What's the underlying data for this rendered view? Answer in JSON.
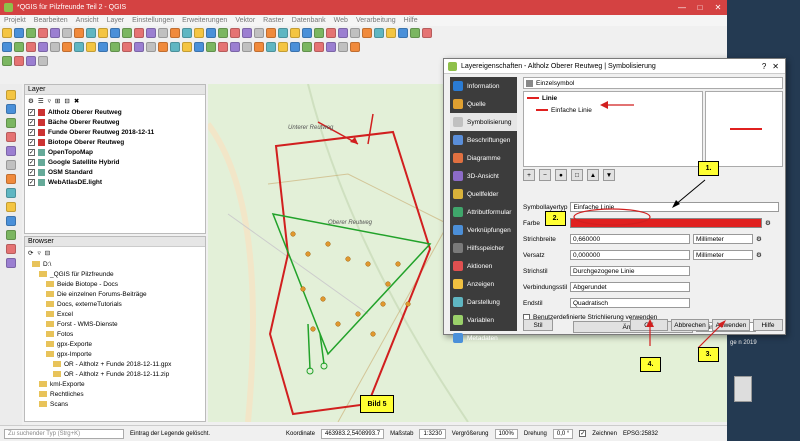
{
  "window": {
    "title": "*QGIS für Pilzfreunde Teil 2 - QGIS"
  },
  "menu": [
    "Projekt",
    "Bearbeiten",
    "Ansicht",
    "Layer",
    "Einstellungen",
    "Erweiterungen",
    "Vektor",
    "Raster",
    "Datenbank",
    "Web",
    "Verarbeitung",
    "Hilfe"
  ],
  "layers_panel": {
    "title": "Layer",
    "items": [
      {
        "label": "Altholz Oberer Reutweg",
        "checked": true
      },
      {
        "label": "Bäche Oberer Reutweg",
        "checked": true
      },
      {
        "label": "Funde Oberer Reutweg 2018-12-11",
        "checked": true
      },
      {
        "label": "Biotope Oberer Reutweg",
        "checked": true
      },
      {
        "label": "OpenTopoMap",
        "checked": true
      },
      {
        "label": "Google Satellite Hybrid",
        "checked": true
      },
      {
        "label": "OSM Standard",
        "checked": true
      },
      {
        "label": "WebAtlasDE.light",
        "checked": true
      }
    ]
  },
  "browser_panel": {
    "title": "Browser",
    "items": [
      {
        "label": "D:\\",
        "depth": 1
      },
      {
        "label": "_QGIS für Pilzfreunde",
        "depth": 2
      },
      {
        "label": "Beide Biotope - Docs",
        "depth": 3
      },
      {
        "label": "Die einzelnen Forums-Beiträge",
        "depth": 3
      },
      {
        "label": "Docs, externeTutorials",
        "depth": 3
      },
      {
        "label": "Excel",
        "depth": 3
      },
      {
        "label": "Forst - WMS-Dienste",
        "depth": 3
      },
      {
        "label": "Fotos",
        "depth": 3
      },
      {
        "label": "gpx-Exporte",
        "depth": 3
      },
      {
        "label": "gpx-Importe",
        "depth": 3
      },
      {
        "label": "OR - Altholz + Funde 2018-12-11.gpx",
        "depth": 4
      },
      {
        "label": "OR - Altholz + Funde 2018-12-11.zip",
        "depth": 4
      },
      {
        "label": "kml-Exporte",
        "depth": 2
      },
      {
        "label": "Rechtliches",
        "depth": 2
      },
      {
        "label": "Scans",
        "depth": 2
      }
    ]
  },
  "map": {
    "labels": [
      "Unterer Reutweg",
      "Oberer Reutweg",
      "Bild 5"
    ]
  },
  "status": {
    "search_placeholder": "Zu suchender Typ (Strg+K)",
    "message": "Eintrag der Legende gelöscht.",
    "coord_label": "Koordinate",
    "coord": "463983.2,5408993.7",
    "scale_label": "Maßstab",
    "scale": "1:3230",
    "mag_label": "Vergrößerung",
    "mag": "100%",
    "rot_label": "Drehung",
    "rot": "0,0 °",
    "render_label": "Zeichnen",
    "crs": "EPSG:25832"
  },
  "dialog": {
    "title": "Layereigenschaften - Altholz Oberer Reutweg | Symbolisierung",
    "renderer": "Einzelsymbol",
    "tree": {
      "root": "Linie",
      "child": "Einfache Linie"
    },
    "nav": [
      "Information",
      "Quelle",
      "Symbolisierung",
      "Beschriftungen",
      "Diagramme",
      "3D-Ansicht",
      "Quellfelder",
      "Attributformular",
      "Verknüpfungen",
      "Hilfsspeicher",
      "Aktionen",
      "Anzeigen",
      "Darstellung",
      "Variablen",
      "Metadaten"
    ],
    "symbollayer_label": "Symbollayertyp",
    "symbollayer": "Einfache Linie",
    "farbe_label": "Farbe",
    "color": "#e0201f",
    "strich_label": "Strichbreite",
    "strich": "0,660000",
    "unit": "Millimeter",
    "versatz_label": "Versatz",
    "versatz": "0,000000",
    "strichstil_label": "Strichstil",
    "strichstil": "Durchgezogene Linie",
    "verbindung_label": "Verbindungsstil",
    "verbindung": "Abgerundet",
    "endstil_label": "Endstil",
    "endstil": "Quadratisch",
    "custom_dash": "Benutzerdefinierte Strichlierung verwenden",
    "aendern": "Ändern",
    "buttons": {
      "stil": "Stil",
      "ok": "OK",
      "abbrechen": "Abbrechen",
      "anwenden": "Anwenden",
      "hilfe": "Hilfe"
    }
  },
  "annotations": [
    "1.",
    "2.",
    "3.",
    "4."
  ],
  "desktop": {
    "date_text": "ge n 2019"
  }
}
